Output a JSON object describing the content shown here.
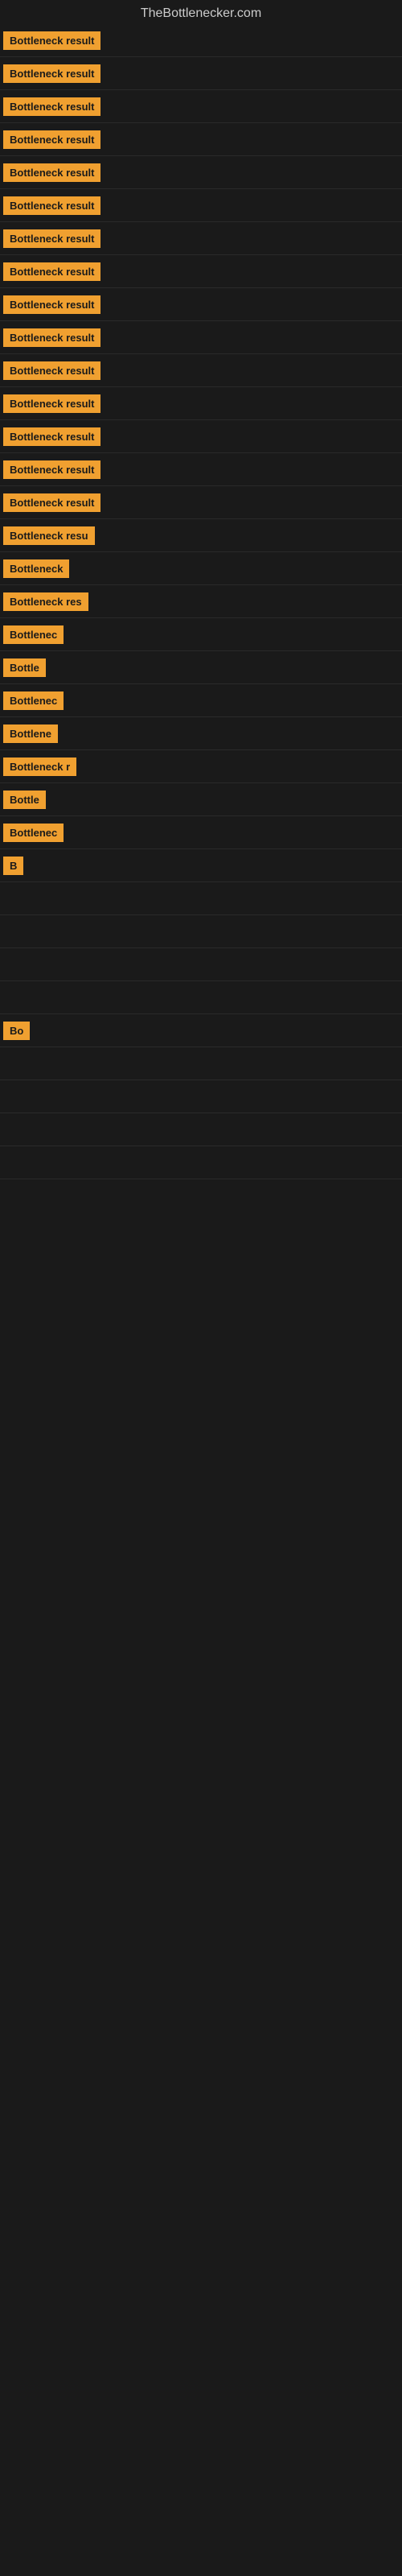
{
  "site_title": "TheBottlenecker.com",
  "rows": [
    {
      "label": "Bottleneck result",
      "bar_width": 0
    },
    {
      "label": "Bottleneck result",
      "bar_width": 0
    },
    {
      "label": "Bottleneck result",
      "bar_width": 0
    },
    {
      "label": "Bottleneck result",
      "bar_width": 0
    },
    {
      "label": "Bottleneck result",
      "bar_width": 0
    },
    {
      "label": "Bottleneck result",
      "bar_width": 0
    },
    {
      "label": "Bottleneck result",
      "bar_width": 0
    },
    {
      "label": "Bottleneck result",
      "bar_width": 0
    },
    {
      "label": "Bottleneck result",
      "bar_width": 0
    },
    {
      "label": "Bottleneck result",
      "bar_width": 0
    },
    {
      "label": "Bottleneck result",
      "bar_width": 0
    },
    {
      "label": "Bottleneck result",
      "bar_width": 0
    },
    {
      "label": "Bottleneck result",
      "bar_width": 0
    },
    {
      "label": "Bottleneck result",
      "bar_width": 0
    },
    {
      "label": "Bottleneck result",
      "bar_width": 0
    },
    {
      "label": "Bottleneck resu",
      "bar_width": 0
    },
    {
      "label": "Bottleneck",
      "bar_width": 0
    },
    {
      "label": "Bottleneck res",
      "bar_width": 0
    },
    {
      "label": "Bottlenec",
      "bar_width": 0
    },
    {
      "label": "Bottle",
      "bar_width": 0
    },
    {
      "label": "Bottlenec",
      "bar_width": 0
    },
    {
      "label": "Bottlene",
      "bar_width": 0
    },
    {
      "label": "Bottleneck r",
      "bar_width": 0
    },
    {
      "label": "Bottle",
      "bar_width": 0
    },
    {
      "label": "Bottlenec",
      "bar_width": 0
    },
    {
      "label": "B",
      "bar_width": 0
    },
    {
      "label": "",
      "bar_width": 0
    },
    {
      "label": "",
      "bar_width": 0
    },
    {
      "label": "",
      "bar_width": 0
    },
    {
      "label": "",
      "bar_width": 0
    },
    {
      "label": "Bo",
      "bar_width": 0
    },
    {
      "label": "",
      "bar_width": 0
    },
    {
      "label": "",
      "bar_width": 0
    },
    {
      "label": "",
      "bar_width": 0
    },
    {
      "label": "",
      "bar_width": 0
    }
  ]
}
